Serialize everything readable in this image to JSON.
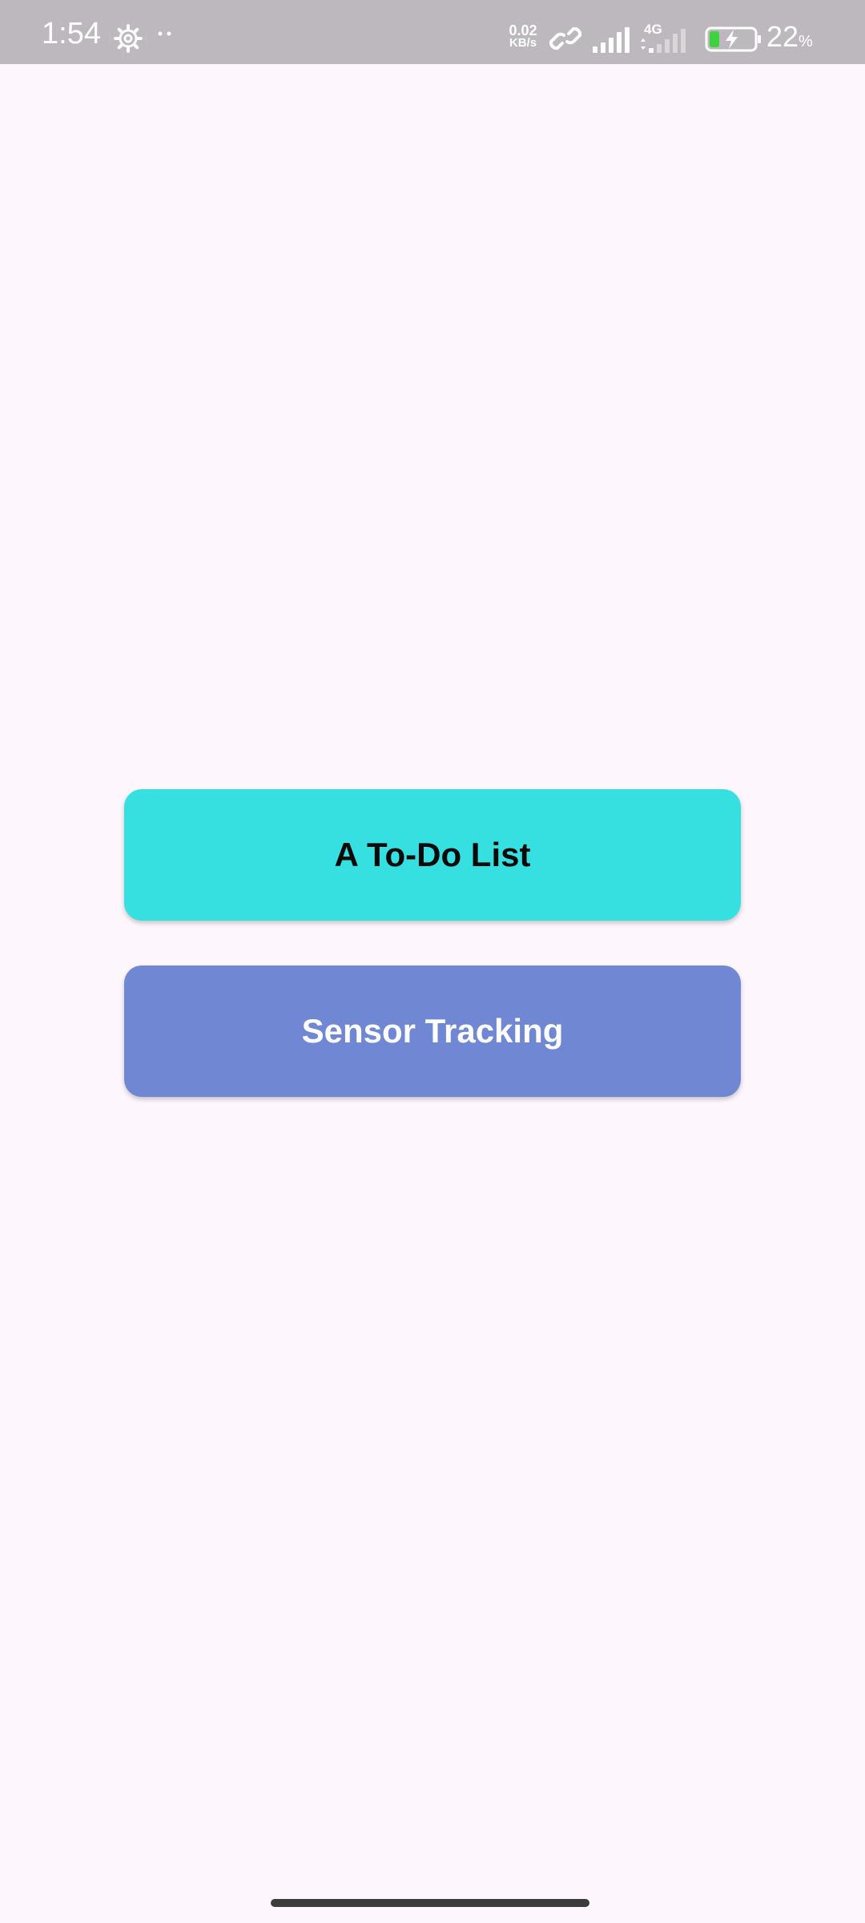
{
  "status_bar": {
    "time": "1:54",
    "net_speed_value": "0.02",
    "net_speed_unit": "KB/s",
    "network_type": "4G",
    "battery_level": "22",
    "battery_unit": "%",
    "icons": [
      "settings-gear-icon",
      "notification-dots-icon",
      "link-icon",
      "signal-icon",
      "signal-4g-icon",
      "battery-charging-icon"
    ]
  },
  "main": {
    "buttons": [
      {
        "label": "A To-Do List",
        "color": "#37e0e0"
      },
      {
        "label": "Sensor Tracking",
        "color": "#7087d4"
      }
    ]
  },
  "colors": {
    "background": "#fdf7fd",
    "status_bar": "#bdb8bd"
  }
}
